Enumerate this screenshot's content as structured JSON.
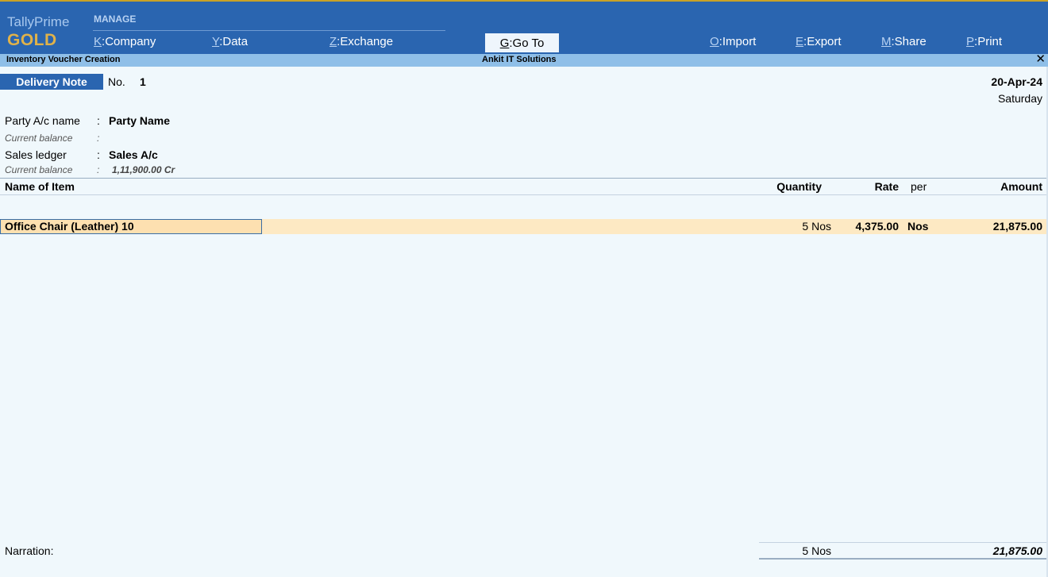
{
  "app": {
    "brand_name": "TallyPrime",
    "brand_edition": "GOLD",
    "manage_label": "MANAGE"
  },
  "menu": [
    {
      "key": "K",
      "label": "Company"
    },
    {
      "key": "Y",
      "label": "Data"
    },
    {
      "key": "Z",
      "label": "Exchange"
    },
    {
      "key": "G",
      "label": "Go To"
    },
    {
      "key": "O",
      "label": "Import"
    },
    {
      "key": "E",
      "label": "Export"
    },
    {
      "key": "M",
      "label": "Share"
    },
    {
      "key": "P",
      "label": "Print"
    }
  ],
  "titlebar": {
    "screen": "Inventory Voucher Creation",
    "company": "Ankit IT Solutions",
    "close_glyph": "✕"
  },
  "voucher": {
    "type": "Delivery Note",
    "no_label": "No.",
    "no": "1",
    "date": "20-Apr-24",
    "day": "Saturday"
  },
  "fields": {
    "party_label": "Party A/c name",
    "party_value": "Party Name",
    "party_balance_label": "Current balance",
    "party_balance_value": "",
    "sales_label": "Sales ledger",
    "sales_value": "Sales A/c",
    "sales_balance_label": "Current balance",
    "sales_balance_value": "1,11,900.00 Cr",
    "colon": ":"
  },
  "columns": {
    "name": "Name of Item",
    "quantity": "Quantity",
    "rate": "Rate",
    "per": "per",
    "amount": "Amount"
  },
  "items": [
    {
      "name": "Office Chair (Leather) 10",
      "quantity": "5 Nos",
      "rate": "4,375.00",
      "per": "Nos",
      "amount": "21,875.00"
    }
  ],
  "footer": {
    "narration_label": "Narration:",
    "total_quantity": "5 Nos",
    "total_amount": "21,875.00"
  },
  "colors": {
    "topbar": "#2a65b0",
    "titlebar": "#8fbfe8",
    "highlight_row": "#fde9c3",
    "brand_gold": "#e0b24a"
  }
}
